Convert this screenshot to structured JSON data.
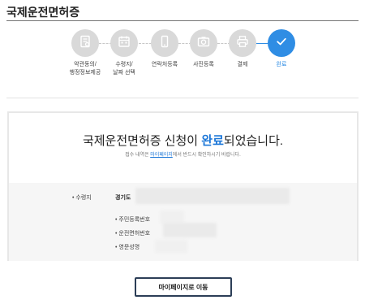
{
  "page": {
    "title": "국제운전면허증"
  },
  "steps": [
    {
      "label": "약관동의/\n행정정보제공",
      "icon": "document-check-icon",
      "state": "done"
    },
    {
      "label": "수령지/\n날짜 선택",
      "icon": "calendar-icon",
      "state": "done"
    },
    {
      "label": "연락처등록",
      "icon": "phone-icon",
      "state": "done"
    },
    {
      "label": "사진등록",
      "icon": "camera-icon",
      "state": "done"
    },
    {
      "label": "결제",
      "icon": "printer-icon",
      "state": "done"
    },
    {
      "label": "완료",
      "icon": "checkmark-icon",
      "state": "active"
    }
  ],
  "result": {
    "message_before": "국제운전면허증 신청이 ",
    "message_highlight": "완료",
    "message_after": "되었습니다.",
    "sub_before": "접수 내역은 ",
    "sub_link": "마이페이지",
    "sub_after": "에서 반드시 확인하시기 바랍니다."
  },
  "info": {
    "pickup_label": "• 수령지",
    "pickup_value": "경기도",
    "rrn_label": "• 주민등록번호",
    "license_label": "• 운전면허번호",
    "name_label": "• 영문성명"
  },
  "button": {
    "mypage_label": "마이페이지로 이동"
  },
  "colors": {
    "accent": "#2f8de4",
    "inactive_step": "#d9d9d9",
    "button_border": "#2c3e57"
  }
}
